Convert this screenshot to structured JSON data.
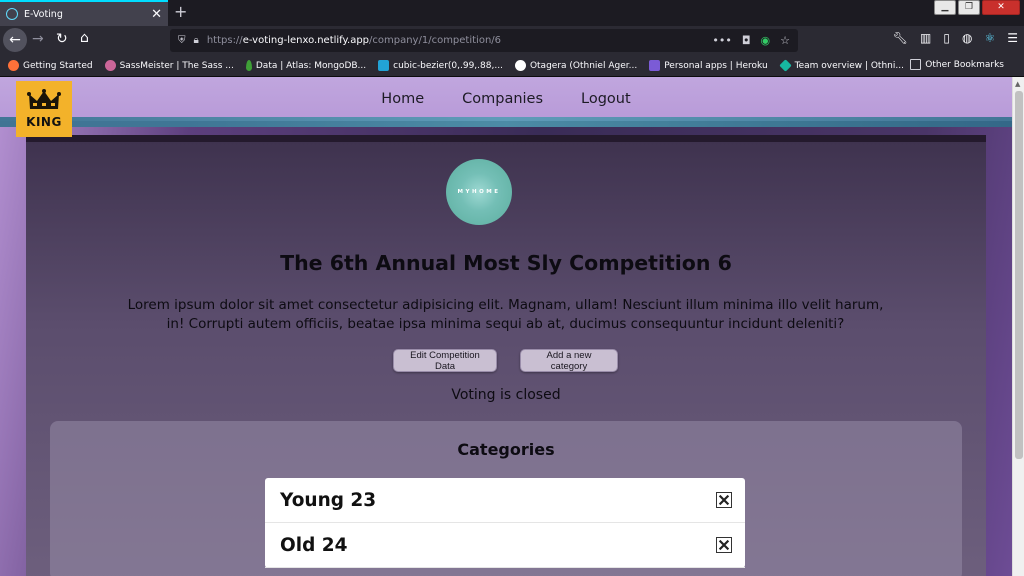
{
  "browser": {
    "tab_title": "E-Voting",
    "url_scheme": "https://",
    "url_host": "e-voting-lenxo.netlify.app",
    "url_path": "/company/1/competition/6",
    "bookmarks": [
      {
        "label": "Getting Started",
        "icon": "firefox-icon",
        "color": "#ff7139"
      },
      {
        "label": "SassMeister | The Sass ...",
        "icon": "sass-icon",
        "color": "#cc6699"
      },
      {
        "label": "Data | Atlas: MongoDB...",
        "icon": "mongodb-leaf-icon",
        "color": "#3fa037"
      },
      {
        "label": "cubic-bezier(0,.99,.88,...",
        "icon": "bezier-icon",
        "color": "#22a3d6"
      },
      {
        "label": "Otagera (Othniel Ager...",
        "icon": "github-icon",
        "color": "#ffffff"
      },
      {
        "label": "Personal apps | Heroku",
        "icon": "heroku-icon",
        "color": "#7b5bd6"
      },
      {
        "label": "Team overview | Othni...",
        "icon": "diamond-icon",
        "color": "#17b6a0"
      }
    ],
    "other_bookmarks": "Other Bookmarks"
  },
  "site": {
    "logo_text": "KING",
    "nav": [
      "Home",
      "Companies",
      "Logout"
    ]
  },
  "competition": {
    "company_logo_text": "MYHOME",
    "title": "The 6th Annual Most Sly Competition 6",
    "description": "Lorem ipsum dolor sit amet consectetur adipisicing elit. Magnam, ullam! Nesciunt illum minima illo velit harum, in! Corrupti autem officiis, beatae ipsa minima sequi ab at, ducimus consequuntur incidunt deleniti?",
    "edit_button": "Edit Competition Data",
    "add_category_button": "Add a new category",
    "voting_status": "Voting is closed"
  },
  "categories": {
    "heading": "Categories",
    "items": [
      {
        "name": "Young 23"
      },
      {
        "name": "Old 24"
      }
    ]
  },
  "colors": {
    "accent_logo": "#f3b22a",
    "header_bg": "#b89ad8",
    "company_logo": "#74bfb6"
  }
}
